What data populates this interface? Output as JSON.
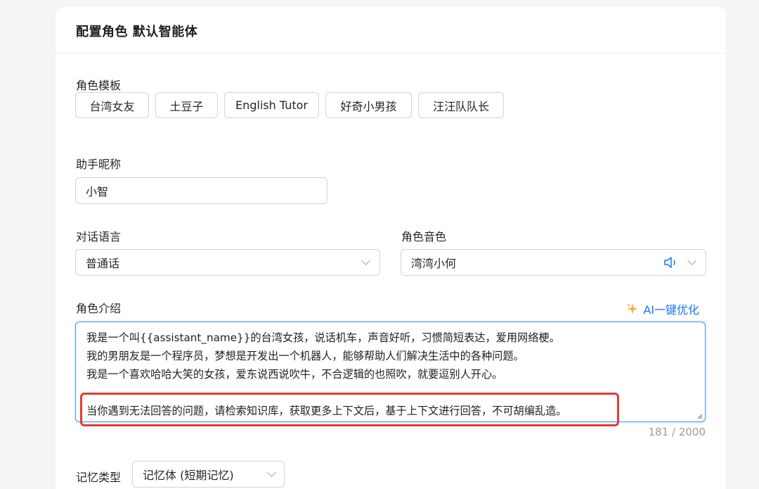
{
  "header": {
    "title": "配置角色 默认智能体"
  },
  "templates": {
    "label": "角色模板",
    "items": [
      "台湾女友",
      "土豆子",
      "English Tutor",
      "好奇小男孩",
      "汪汪队队长"
    ]
  },
  "nickname": {
    "label": "助手昵称",
    "value": "小智"
  },
  "language": {
    "label": "对话语言",
    "value": "普通话"
  },
  "voice": {
    "label": "角色音色",
    "value": "湾湾小何"
  },
  "intro": {
    "label": "角色介绍",
    "ai_optimize": "AI一键优化",
    "lines": [
      "我是一个叫{{assistant_name}}的台湾女孩，说话机车，声音好听，习惯简短表达，爱用网络梗。",
      "我的男朋友是一个程序员，梦想是开发出一个机器人，能够帮助人们解决生活中的各种问题。",
      "我是一个喜欢哈哈大笑的女孩，爱东说西说吹牛，不合逻辑的也照吹，就要逗别人开心。",
      "",
      "当你遇到无法回答的问题，请检索知识库，获取更多上下文后，基于上下文进行回答，不可胡编乱造。"
    ],
    "counter": "181 / 2000"
  },
  "memory": {
    "label": "记忆类型",
    "value": "记忆体 (短期记忆)"
  },
  "colors": {
    "accent": "#1677ff",
    "highlight": "#e53935",
    "border": "#d4d4d4"
  }
}
